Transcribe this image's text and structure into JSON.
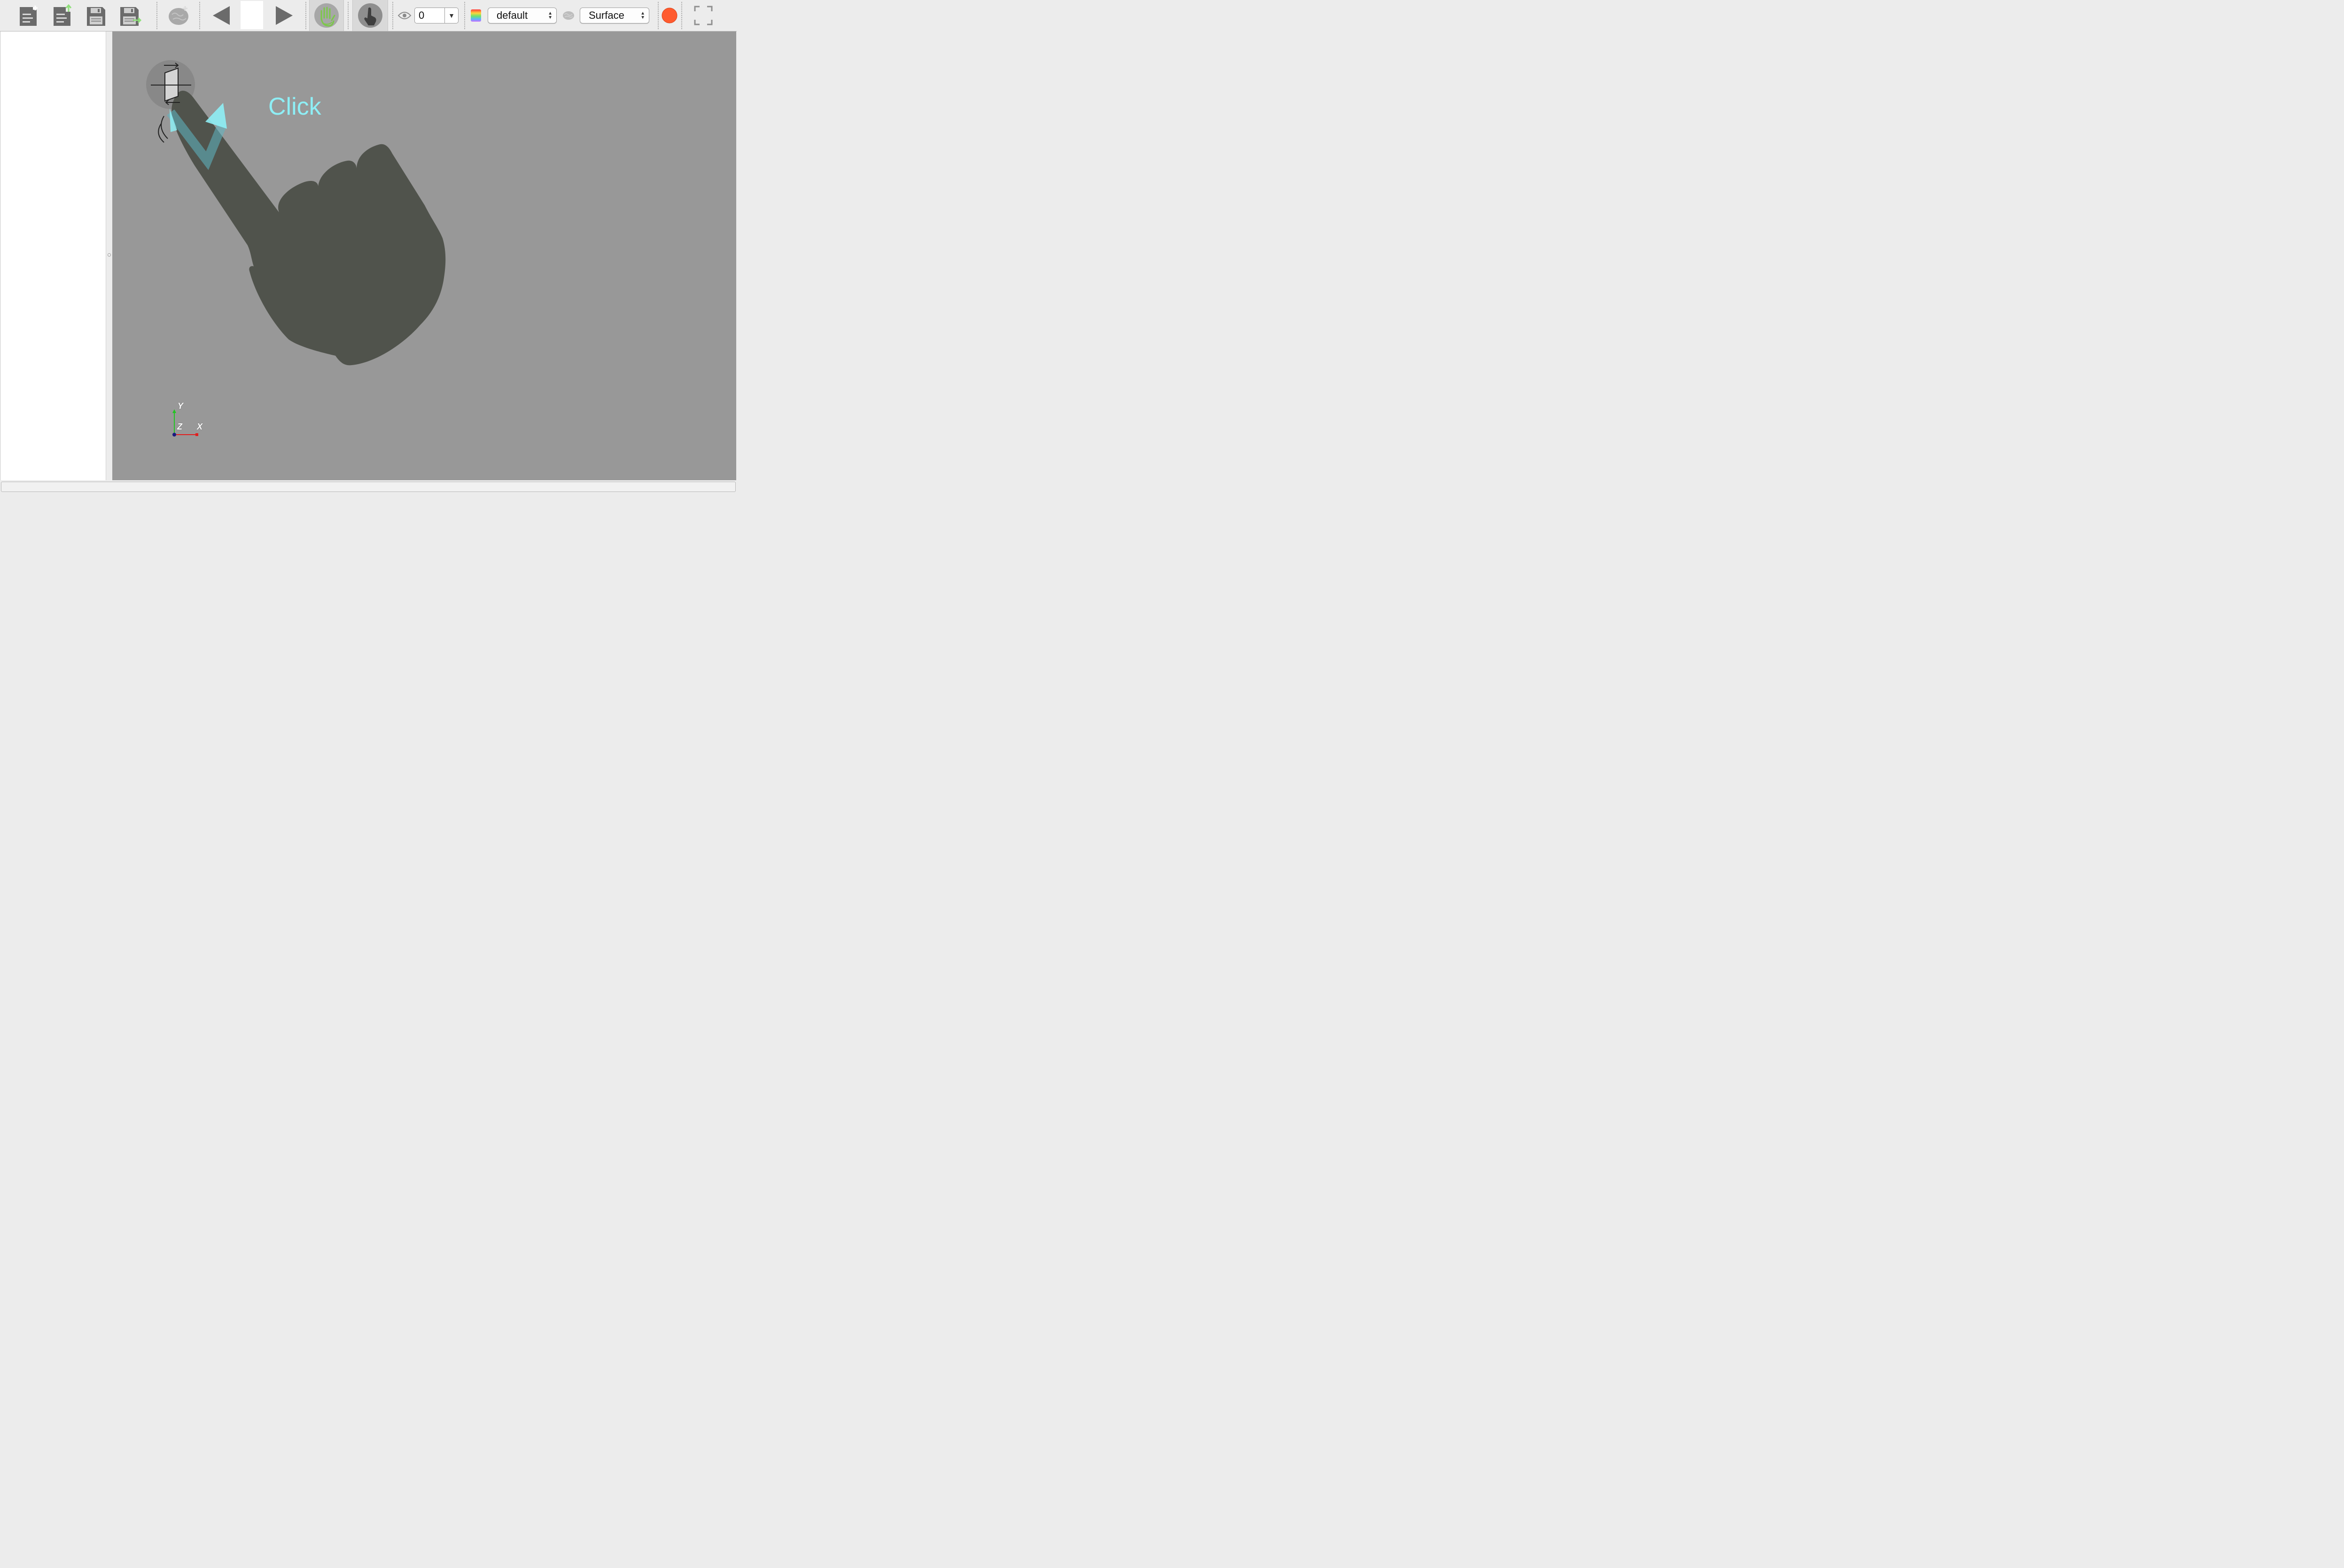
{
  "toolbar": {
    "buttons": {
      "new_document": {
        "icon": "document-add-icon"
      },
      "open_document": {
        "icon": "document-upload-icon"
      },
      "save": {
        "icon": "floppy-save-icon"
      },
      "save_as": {
        "icon": "floppy-save-as-icon"
      },
      "add_brain": {
        "icon": "brain-add-icon"
      },
      "previous": {
        "icon": "triangle-left-icon"
      },
      "next": {
        "icon": "triangle-right-icon"
      },
      "pan_mode": {
        "icon": "hand-icon",
        "pressed": true
      },
      "pointer_mode": {
        "icon": "pointing-hand-icon",
        "pressed": true
      },
      "record": {
        "icon": "record-circle-icon",
        "color": "#ff5a2e"
      },
      "fullscreen": {
        "icon": "fullscreen-corners-icon"
      }
    },
    "visibility_value": "0",
    "colormap_select": "default",
    "surface_select": "Surface"
  },
  "viewport": {
    "hint_text": "Click",
    "hint_color": "#8eeef5",
    "background": "#989898",
    "gesture": {
      "icon": "tap-gesture-icon",
      "hand_color": "#50534c"
    },
    "orientation_axes": {
      "x": "X",
      "y": "Y",
      "z": "Z"
    }
  },
  "status_bar": {
    "text": ""
  }
}
